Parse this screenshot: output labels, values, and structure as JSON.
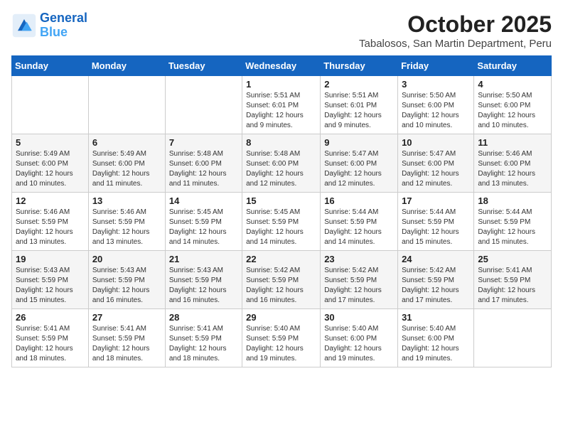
{
  "logo": {
    "line1": "General",
    "line2": "Blue"
  },
  "header": {
    "month": "October 2025",
    "location": "Tabalosos, San Martin Department, Peru"
  },
  "weekdays": [
    "Sunday",
    "Monday",
    "Tuesday",
    "Wednesday",
    "Thursday",
    "Friday",
    "Saturday"
  ],
  "weeks": [
    [
      {
        "day": "",
        "info": ""
      },
      {
        "day": "",
        "info": ""
      },
      {
        "day": "",
        "info": ""
      },
      {
        "day": "1",
        "info": "Sunrise: 5:51 AM\nSunset: 6:01 PM\nDaylight: 12 hours and 9 minutes."
      },
      {
        "day": "2",
        "info": "Sunrise: 5:51 AM\nSunset: 6:01 PM\nDaylight: 12 hours and 9 minutes."
      },
      {
        "day": "3",
        "info": "Sunrise: 5:50 AM\nSunset: 6:00 PM\nDaylight: 12 hours and 10 minutes."
      },
      {
        "day": "4",
        "info": "Sunrise: 5:50 AM\nSunset: 6:00 PM\nDaylight: 12 hours and 10 minutes."
      }
    ],
    [
      {
        "day": "5",
        "info": "Sunrise: 5:49 AM\nSunset: 6:00 PM\nDaylight: 12 hours and 10 minutes."
      },
      {
        "day": "6",
        "info": "Sunrise: 5:49 AM\nSunset: 6:00 PM\nDaylight: 12 hours and 11 minutes."
      },
      {
        "day": "7",
        "info": "Sunrise: 5:48 AM\nSunset: 6:00 PM\nDaylight: 12 hours and 11 minutes."
      },
      {
        "day": "8",
        "info": "Sunrise: 5:48 AM\nSunset: 6:00 PM\nDaylight: 12 hours and 12 minutes."
      },
      {
        "day": "9",
        "info": "Sunrise: 5:47 AM\nSunset: 6:00 PM\nDaylight: 12 hours and 12 minutes."
      },
      {
        "day": "10",
        "info": "Sunrise: 5:47 AM\nSunset: 6:00 PM\nDaylight: 12 hours and 12 minutes."
      },
      {
        "day": "11",
        "info": "Sunrise: 5:46 AM\nSunset: 6:00 PM\nDaylight: 12 hours and 13 minutes."
      }
    ],
    [
      {
        "day": "12",
        "info": "Sunrise: 5:46 AM\nSunset: 5:59 PM\nDaylight: 12 hours and 13 minutes."
      },
      {
        "day": "13",
        "info": "Sunrise: 5:46 AM\nSunset: 5:59 PM\nDaylight: 12 hours and 13 minutes."
      },
      {
        "day": "14",
        "info": "Sunrise: 5:45 AM\nSunset: 5:59 PM\nDaylight: 12 hours and 14 minutes."
      },
      {
        "day": "15",
        "info": "Sunrise: 5:45 AM\nSunset: 5:59 PM\nDaylight: 12 hours and 14 minutes."
      },
      {
        "day": "16",
        "info": "Sunrise: 5:44 AM\nSunset: 5:59 PM\nDaylight: 12 hours and 14 minutes."
      },
      {
        "day": "17",
        "info": "Sunrise: 5:44 AM\nSunset: 5:59 PM\nDaylight: 12 hours and 15 minutes."
      },
      {
        "day": "18",
        "info": "Sunrise: 5:44 AM\nSunset: 5:59 PM\nDaylight: 12 hours and 15 minutes."
      }
    ],
    [
      {
        "day": "19",
        "info": "Sunrise: 5:43 AM\nSunset: 5:59 PM\nDaylight: 12 hours and 15 minutes."
      },
      {
        "day": "20",
        "info": "Sunrise: 5:43 AM\nSunset: 5:59 PM\nDaylight: 12 hours and 16 minutes."
      },
      {
        "day": "21",
        "info": "Sunrise: 5:43 AM\nSunset: 5:59 PM\nDaylight: 12 hours and 16 minutes."
      },
      {
        "day": "22",
        "info": "Sunrise: 5:42 AM\nSunset: 5:59 PM\nDaylight: 12 hours and 16 minutes."
      },
      {
        "day": "23",
        "info": "Sunrise: 5:42 AM\nSunset: 5:59 PM\nDaylight: 12 hours and 17 minutes."
      },
      {
        "day": "24",
        "info": "Sunrise: 5:42 AM\nSunset: 5:59 PM\nDaylight: 12 hours and 17 minutes."
      },
      {
        "day": "25",
        "info": "Sunrise: 5:41 AM\nSunset: 5:59 PM\nDaylight: 12 hours and 17 minutes."
      }
    ],
    [
      {
        "day": "26",
        "info": "Sunrise: 5:41 AM\nSunset: 5:59 PM\nDaylight: 12 hours and 18 minutes."
      },
      {
        "day": "27",
        "info": "Sunrise: 5:41 AM\nSunset: 5:59 PM\nDaylight: 12 hours and 18 minutes."
      },
      {
        "day": "28",
        "info": "Sunrise: 5:41 AM\nSunset: 5:59 PM\nDaylight: 12 hours and 18 minutes."
      },
      {
        "day": "29",
        "info": "Sunrise: 5:40 AM\nSunset: 5:59 PM\nDaylight: 12 hours and 19 minutes."
      },
      {
        "day": "30",
        "info": "Sunrise: 5:40 AM\nSunset: 6:00 PM\nDaylight: 12 hours and 19 minutes."
      },
      {
        "day": "31",
        "info": "Sunrise: 5:40 AM\nSunset: 6:00 PM\nDaylight: 12 hours and 19 minutes."
      },
      {
        "day": "",
        "info": ""
      }
    ]
  ]
}
